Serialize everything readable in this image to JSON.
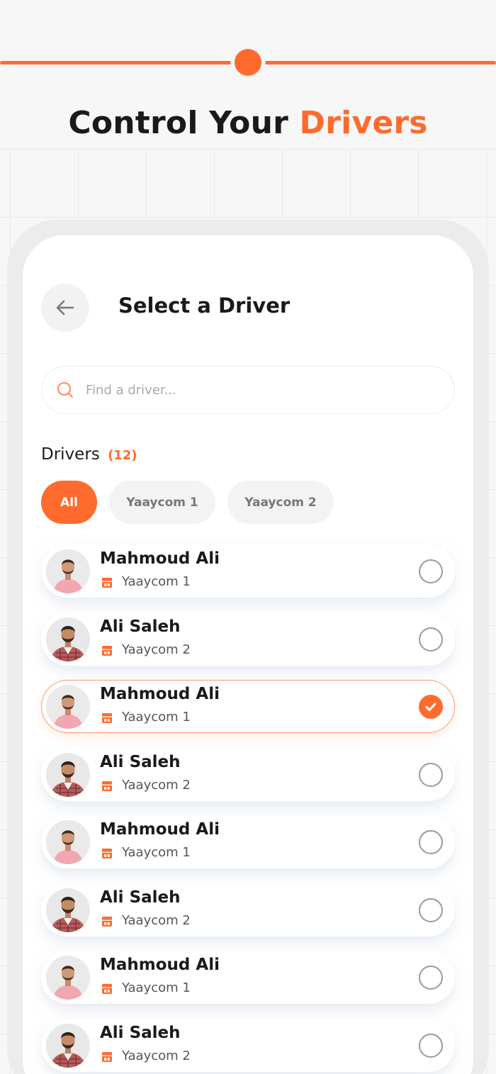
{
  "headline": {
    "part1": "Control Your",
    "part2": "Drivers"
  },
  "screen": {
    "title": "Select a Driver",
    "search_placeholder": "Find a driver...",
    "drivers_label": "Drivers",
    "drivers_count": "(12)"
  },
  "filters": [
    {
      "label": "All",
      "active": true
    },
    {
      "label": "Yaaycom 1",
      "active": false
    },
    {
      "label": "Yaaycom 2",
      "active": false
    }
  ],
  "drivers": [
    {
      "name": "Mahmoud Ali",
      "team": "Yaaycom 1",
      "selected": false,
      "avatar": "avatar-pink-shirt"
    },
    {
      "name": "Ali Saleh",
      "team": "Yaaycom 2",
      "selected": false,
      "avatar": "avatar-plaid-shirt"
    },
    {
      "name": "Mahmoud Ali",
      "team": "Yaaycom 1",
      "selected": true,
      "avatar": "avatar-pink-shirt"
    },
    {
      "name": "Ali Saleh",
      "team": "Yaaycom 2",
      "selected": false,
      "avatar": "avatar-plaid-shirt"
    },
    {
      "name": "Mahmoud Ali",
      "team": "Yaaycom 1",
      "selected": false,
      "avatar": "avatar-pink-shirt"
    },
    {
      "name": "Ali Saleh",
      "team": "Yaaycom 2",
      "selected": false,
      "avatar": "avatar-plaid-shirt"
    },
    {
      "name": "Mahmoud Ali",
      "team": "Yaaycom 1",
      "selected": false,
      "avatar": "avatar-pink-shirt"
    },
    {
      "name": "Ali Saleh",
      "team": "Yaaycom 2",
      "selected": false,
      "avatar": "avatar-plaid-shirt"
    }
  ],
  "colors": {
    "accent": "#ff6b2c",
    "background": "#f7f7f7",
    "card": "#ffffff"
  },
  "icons": {
    "back": "arrow-left-icon",
    "search": "search-icon",
    "team": "store-icon",
    "check": "check-icon"
  }
}
